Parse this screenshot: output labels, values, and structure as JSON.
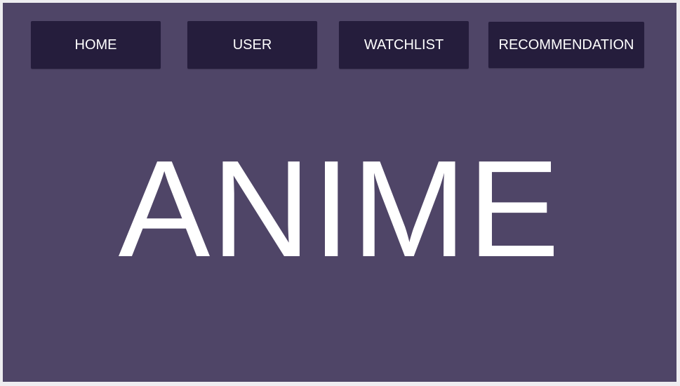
{
  "nav": {
    "items": [
      {
        "label": "HOME"
      },
      {
        "label": "USER"
      },
      {
        "label": "WATCHLIST"
      },
      {
        "label": "RECOMMENDATION"
      }
    ]
  },
  "hero": {
    "title": "ANIME"
  },
  "colors": {
    "page_background": "#eeedf0",
    "panel_background": "#4f4567",
    "button_background": "#251d3c",
    "text": "#ffffff"
  }
}
